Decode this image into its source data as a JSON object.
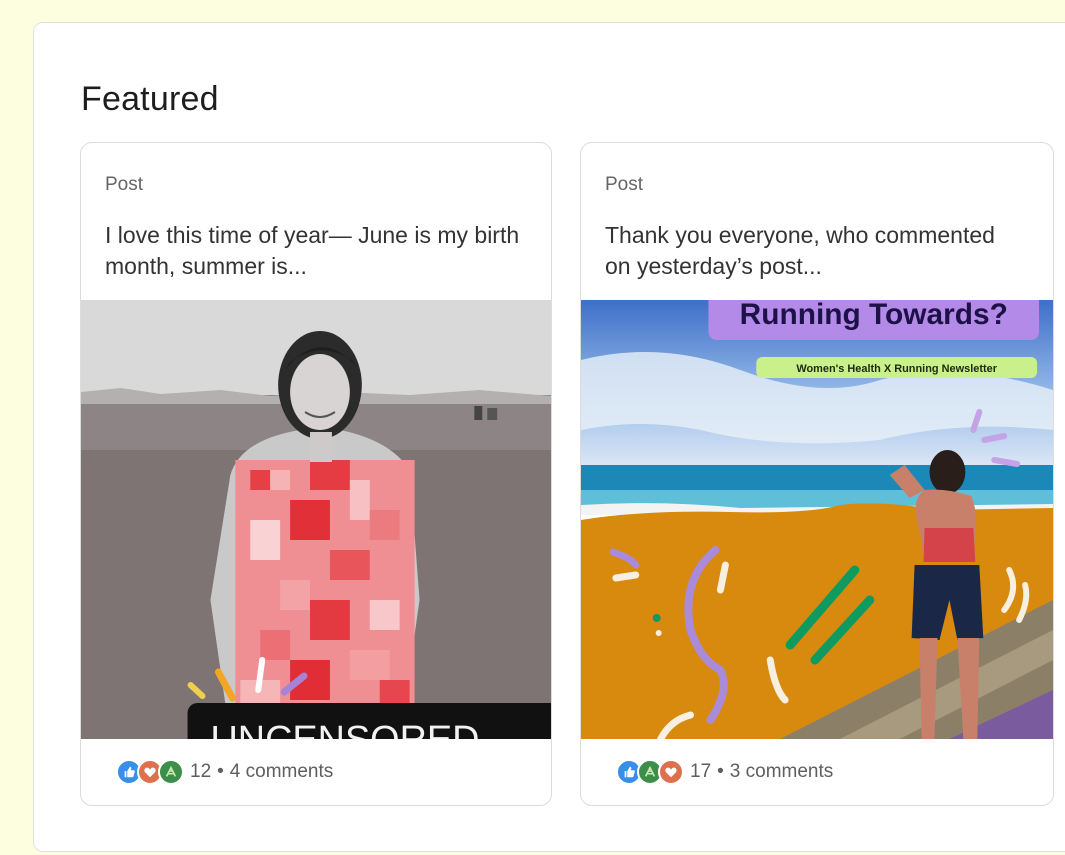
{
  "section": {
    "title": "Featured"
  },
  "cards": [
    {
      "type_label": "Post",
      "text": "I love this time of year— June is my birth month, summer is...",
      "image_banner": "UNCENSORED",
      "reactions": [
        "like-icon",
        "love-icon",
        "support-icon"
      ],
      "reaction_count": "12",
      "separator": "•",
      "comments": "4 comments"
    },
    {
      "type_label": "Post",
      "text": "Thank you everyone, who commented on yesterday’s post...",
      "image_headline": "Running Towards?",
      "image_tag": "Women's Health X Running Newsletter",
      "reactions": [
        "like-icon",
        "support-icon",
        "love-icon"
      ],
      "reaction_count": "17",
      "separator": "•",
      "comments": "3 comments"
    }
  ],
  "colors": {
    "page_bg": "#fdfde0",
    "like": "#378fe9",
    "love": "#df704d",
    "support": "#3d8e4a",
    "headline_bg": "#b48ae8",
    "tag_bg": "#c9f08a",
    "sand": "#d88a0f"
  }
}
